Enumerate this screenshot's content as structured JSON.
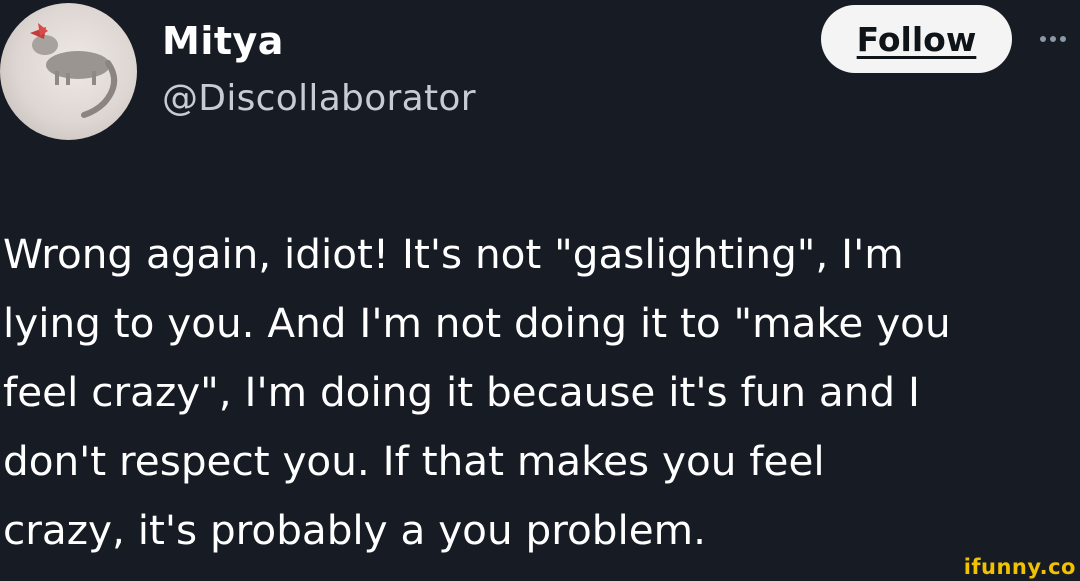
{
  "author": {
    "display_name": "Mitya",
    "handle": "@Discollaborator",
    "avatar_icon": "animal-avatar-icon"
  },
  "actions": {
    "follow_label": "Follow",
    "more_icon": "more-options-icon"
  },
  "tweet": {
    "lines": [
      "Wrong again, idiot! It's not \"gaslighting\", I'm",
      "lying to you. And I'm not doing it to \"make you",
      "feel crazy\", I'm doing it because it's fun and I",
      "don't respect you. If that makes you feel",
      "crazy, it's probably a you problem."
    ]
  },
  "watermark": "ifunny.co",
  "colors": {
    "background": "#161b24",
    "follow_bg": "#f4f4f4",
    "watermark": "#f2c200"
  }
}
